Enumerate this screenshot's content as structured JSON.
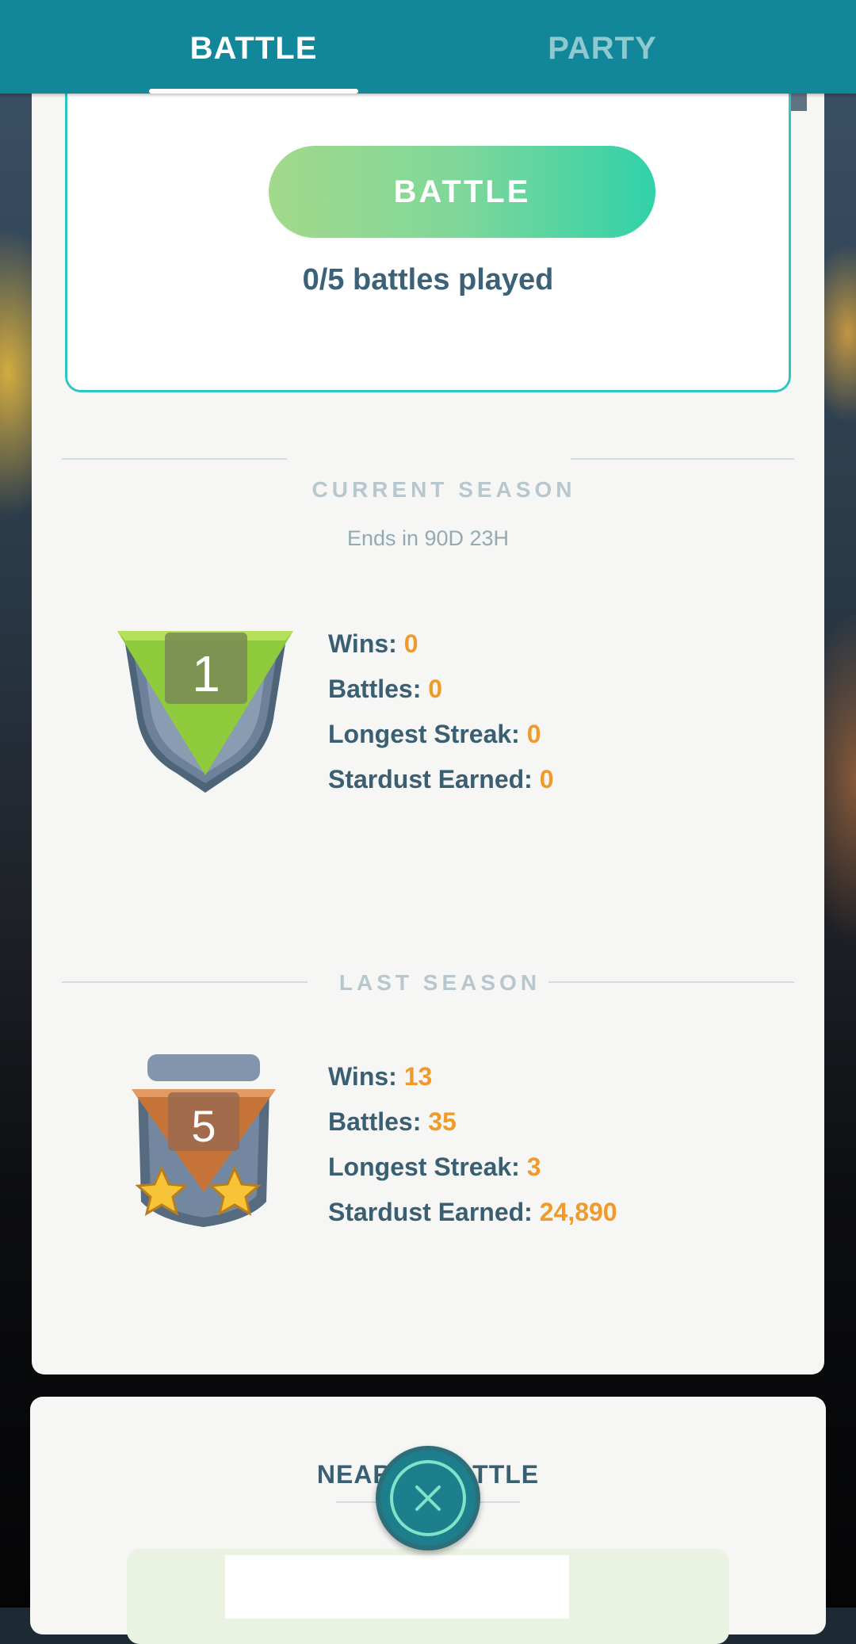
{
  "tabs": {
    "battle": "BATTLE",
    "party": "PARTY"
  },
  "league": {
    "battle_button": "BATTLE",
    "battles_played": "0/5 battles played"
  },
  "current_season": {
    "title": "CURRENT SEASON",
    "ends": "Ends in 90D 23H",
    "rank": "1",
    "stats": [
      {
        "label": "Wins:",
        "value": "0"
      },
      {
        "label": "Battles:",
        "value": "0"
      },
      {
        "label": "Longest Streak:",
        "value": "0"
      },
      {
        "label": "Stardust Earned:",
        "value": "0"
      }
    ]
  },
  "last_season": {
    "title": "LAST SEASON",
    "rank": "5",
    "stars": 2,
    "stats": [
      {
        "label": "Wins:",
        "value": "13"
      },
      {
        "label": "Battles:",
        "value": "35"
      },
      {
        "label": "Longest Streak:",
        "value": "3"
      },
      {
        "label": "Stardust Earned:",
        "value": "24,890"
      }
    ]
  },
  "nearby": {
    "title": "NEARBY BATTLE"
  },
  "icons": {
    "close": "close-icon",
    "star": "star-icon"
  },
  "colors": {
    "topbar": "#12879a",
    "accent_value": "#f09a2b",
    "stat_label": "#3a5f72",
    "card_border": "#2fc6c2"
  }
}
